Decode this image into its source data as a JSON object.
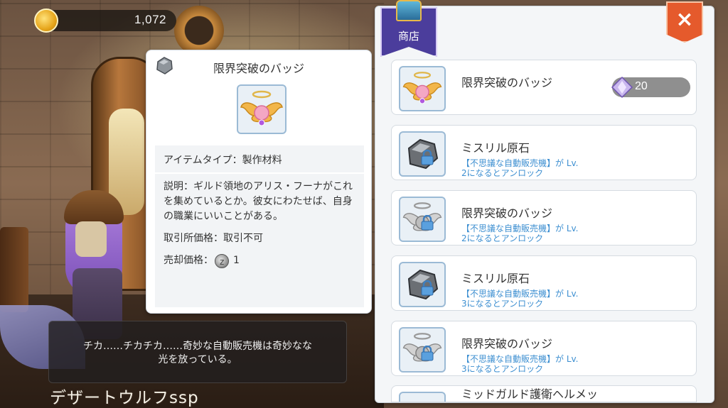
{
  "currency": {
    "amount": "1,072",
    "icon": "gold-coin-icon"
  },
  "detail": {
    "title": "限界突破のバッジ",
    "item_type": "アイテムタイプ：製作材料",
    "description": "説明：ギルド領地のアリス・フーナがこれを集めているとか。彼女にわたせば、自身の職業にいいことがある。",
    "trade_price": "取引所価格：取引不可",
    "sell_price_label": "売却価格：",
    "sell_price_value": "1"
  },
  "shop": {
    "banner_label": "商店",
    "close_label": "×",
    "items": [
      {
        "name": "限界突破のバッジ",
        "price": "20",
        "locked": false,
        "icon": "winged-badge-icon"
      },
      {
        "name": "ミスリル原石",
        "unlock_line1": "【不思議な自動販売機】が Lv.",
        "unlock_line2": "2になるとアンロック",
        "locked": true,
        "icon": "mithril-ore-icon"
      },
      {
        "name": "限界突破のバッジ",
        "unlock_line1": "【不思議な自動販売機】が Lv.",
        "unlock_line2": "2になるとアンロック",
        "locked": true,
        "icon": "winged-badge-icon"
      },
      {
        "name": "ミスリル原石",
        "unlock_line1": "【不思議な自動販売機】が Lv.",
        "unlock_line2": "3になるとアンロック",
        "locked": true,
        "icon": "mithril-ore-icon"
      },
      {
        "name": "限界突破のバッジ",
        "unlock_line1": "【不思議な自動販売機】が Lv.",
        "unlock_line2": "3になるとアンロック",
        "locked": true,
        "icon": "winged-badge-icon"
      },
      {
        "name": "ミッドガルド護衛ヘルメッ",
        "locked": true,
        "icon": "helmet-icon"
      }
    ]
  },
  "dialog": {
    "line1": "チカ……チカチカ……奇妙な自動販売機は奇妙なな",
    "line2": "光を放っている。"
  },
  "npc_name": "デザートウルフssp"
}
